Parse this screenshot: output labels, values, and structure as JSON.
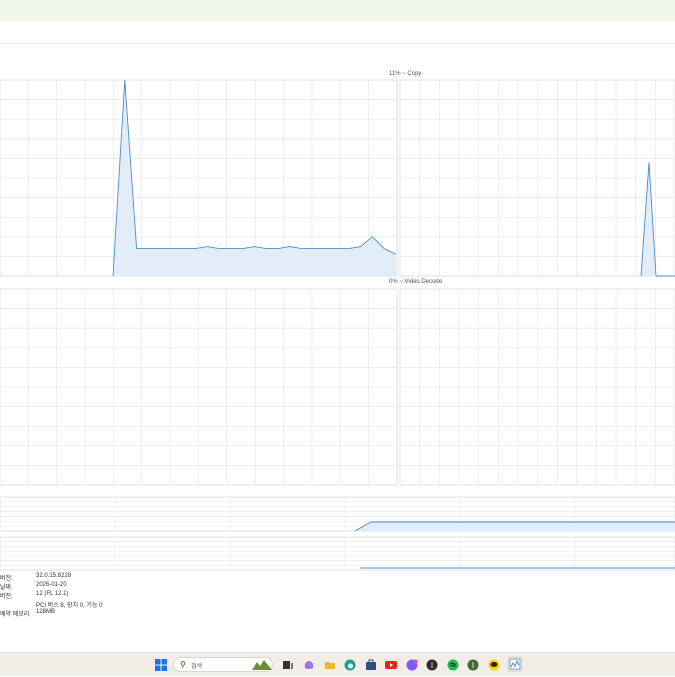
{
  "engines": [
    {
      "label": "11% ~ Copy",
      "utilization": 11
    },
    {
      "label": "0% ~ Video Decode",
      "utilization": 0
    }
  ],
  "chart_data": [
    {
      "type": "area",
      "title": "Copy",
      "ylim": [
        0,
        100
      ],
      "grid": true,
      "series": [
        {
          "values": [
            0,
            100,
            14,
            14,
            14,
            14,
            14,
            14,
            15,
            14,
            14,
            14,
            15,
            14,
            14,
            15,
            14,
            14,
            14,
            14,
            14,
            15,
            20,
            14,
            11
          ]
        }
      ]
    },
    {
      "type": "area",
      "title": "Video Decode",
      "ylim": [
        0,
        100
      ],
      "grid": true,
      "series": [
        {
          "values": []
        }
      ]
    }
  ],
  "details": [
    {
      "key": "버전:",
      "value": "32.0.15.8228"
    },
    {
      "key": "날짜:",
      "value": "2026-01-20"
    },
    {
      "key": "버전:",
      "value": "12 (FL 12.1)"
    },
    {
      "key": "",
      "value": "PCI 버스 8, 장치 0, 기능 0"
    },
    {
      "key": "예약 메모리:",
      "value": "128MB"
    }
  ],
  "taskbar": {
    "search_placeholder": "검색",
    "colors": {
      "accent": "#4a8fc9",
      "fill": "#e3edf7",
      "grid": "#e3e3e3"
    },
    "apps": [
      {
        "name": "windows-start-icon",
        "color": "#1a73e8"
      },
      {
        "name": "widgets-icon",
        "color": "#6b8e3a"
      },
      {
        "name": "task-view-icon",
        "color": "#333333"
      },
      {
        "name": "copilot-icon",
        "color": "#c75bd8"
      },
      {
        "name": "file-explorer-icon",
        "color": "#f2b632"
      },
      {
        "name": "edge-icon",
        "color": "#1f9e8f"
      },
      {
        "name": "store-icon",
        "color": "#2b4e7a"
      },
      {
        "name": "youtube-icon",
        "color": "#e62117"
      },
      {
        "name": "discord-icon",
        "color": "#7a5cff"
      },
      {
        "name": "app-dark-icon",
        "color": "#2d2d2d"
      },
      {
        "name": "spotify-icon",
        "color": "#1db954"
      },
      {
        "name": "app-green-icon",
        "color": "#3f6b3a"
      },
      {
        "name": "kakaotalk-icon",
        "color": "#f7d600"
      },
      {
        "name": "task-manager-icon",
        "color": "#7aa3c8"
      }
    ]
  }
}
